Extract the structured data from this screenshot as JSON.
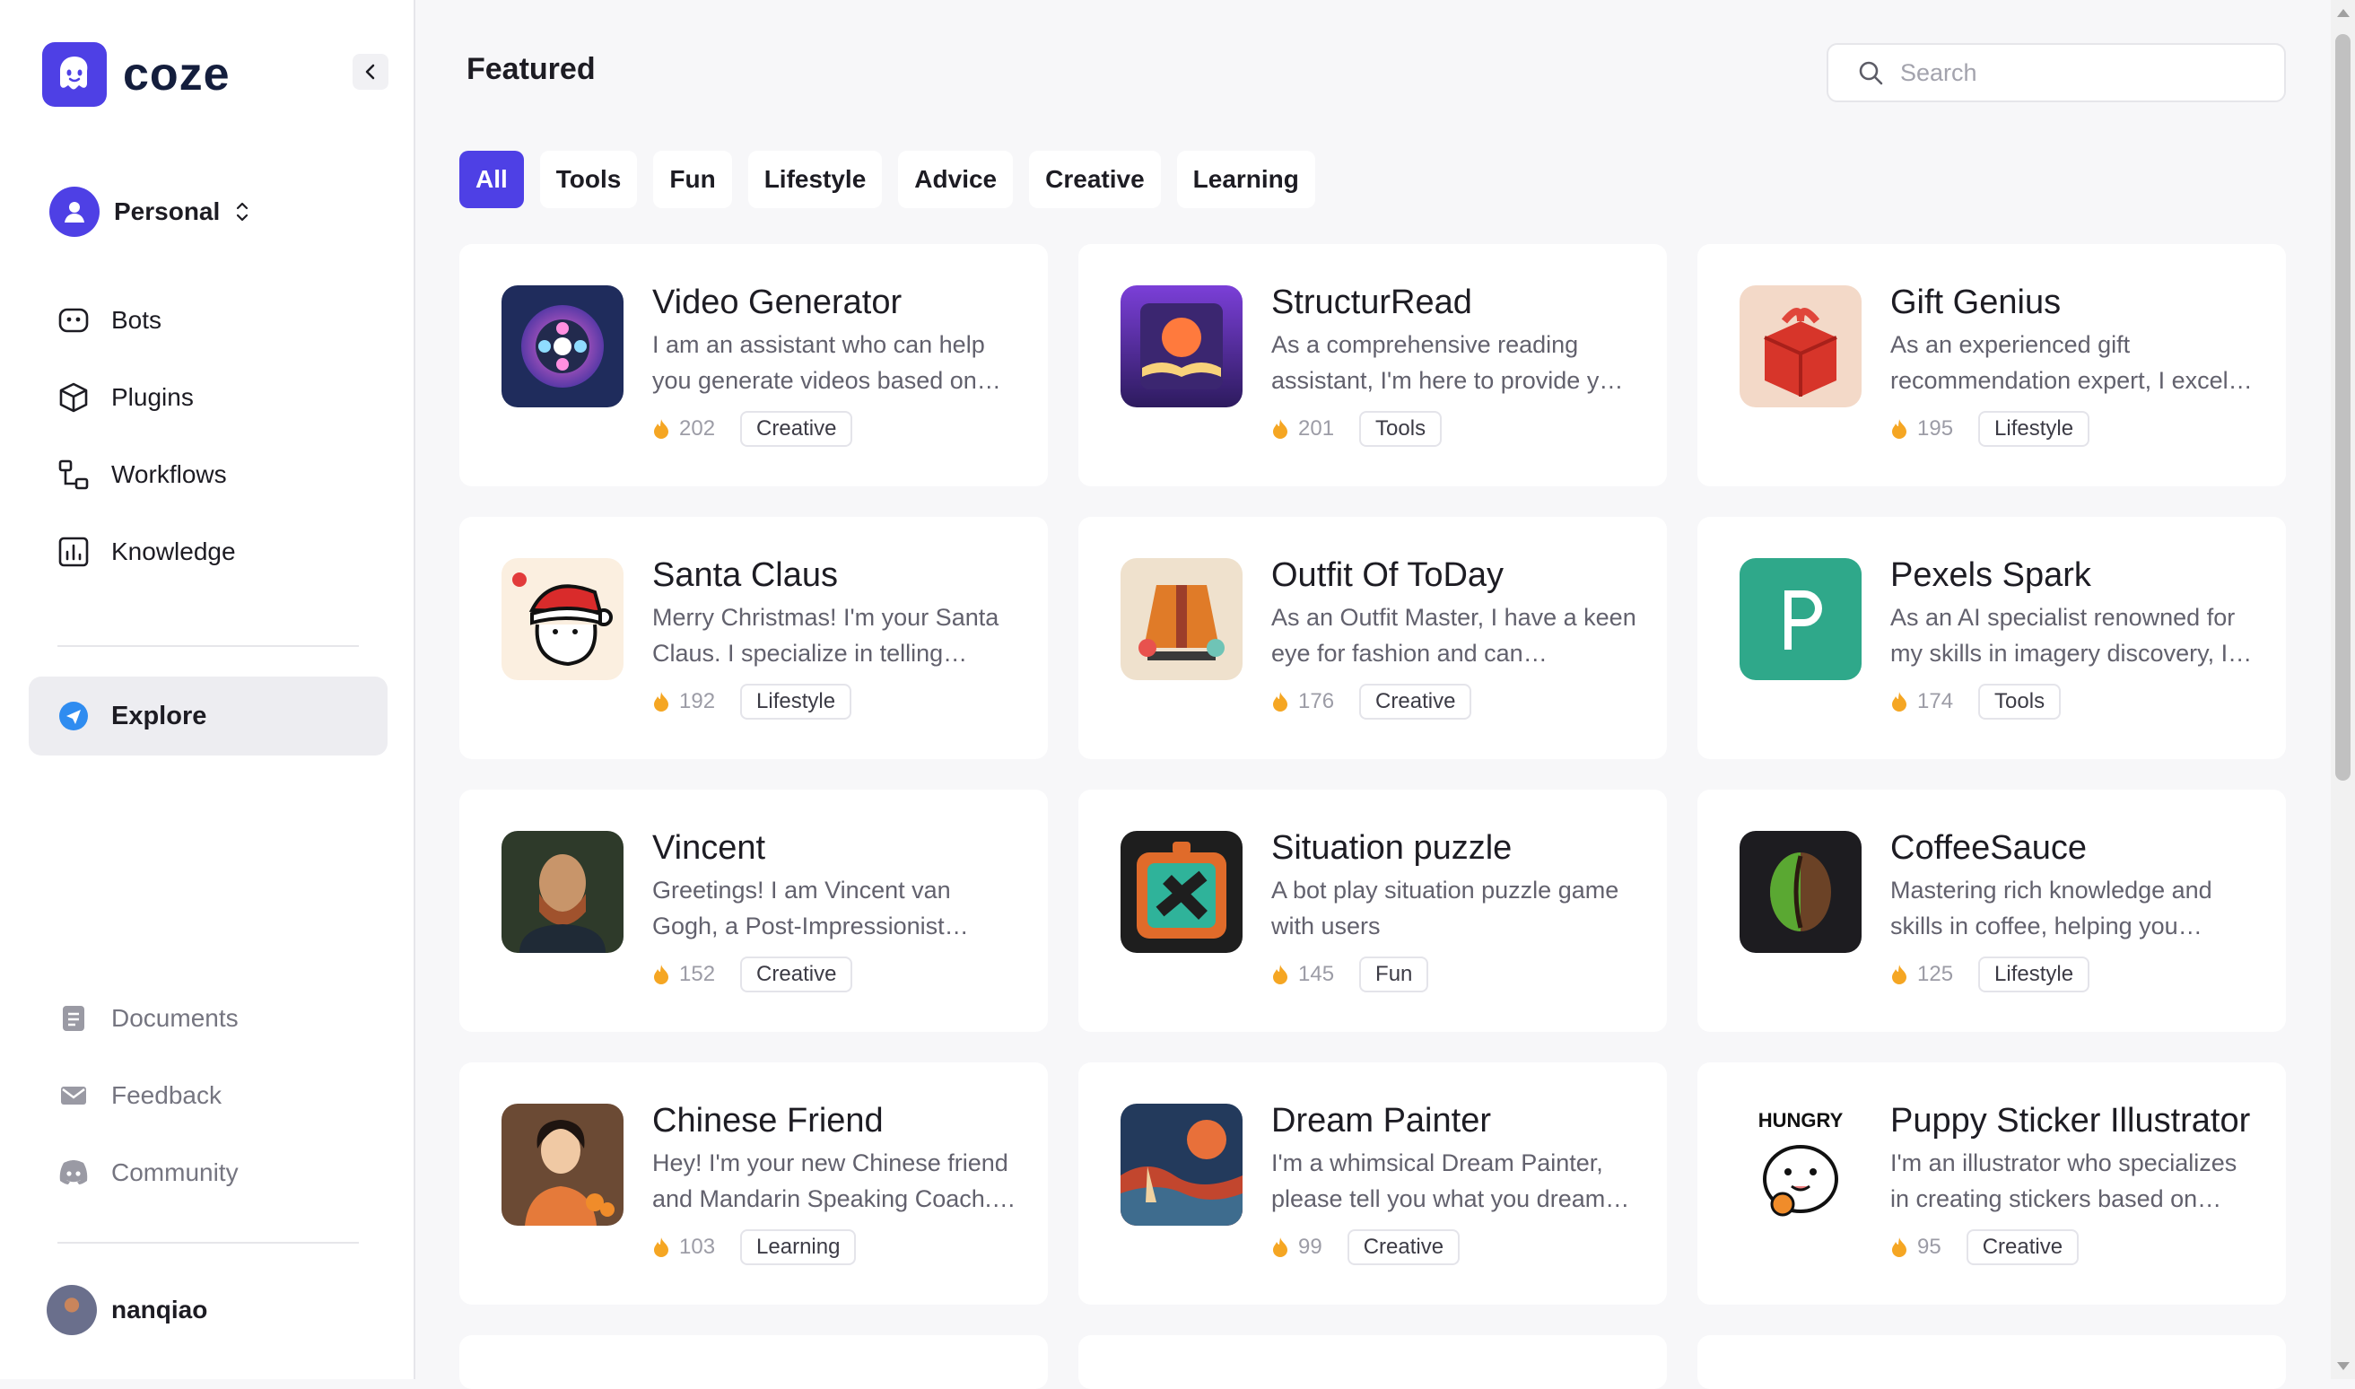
{
  "app": {
    "name": "coze"
  },
  "sidebar": {
    "space": {
      "label": "Personal"
    },
    "nav": [
      {
        "label": "Bots",
        "icon": "bot-icon"
      },
      {
        "label": "Plugins",
        "icon": "cube-icon"
      },
      {
        "label": "Workflows",
        "icon": "workflow-icon"
      },
      {
        "label": "Knowledge",
        "icon": "chart-icon"
      }
    ],
    "explore": {
      "label": "Explore",
      "icon": "compass-icon"
    },
    "bottom": [
      {
        "label": "Documents",
        "icon": "document-icon"
      },
      {
        "label": "Feedback",
        "icon": "mail-icon"
      },
      {
        "label": "Community",
        "icon": "discord-icon"
      }
    ],
    "user": {
      "name": "nanqiao"
    }
  },
  "main": {
    "title": "Featured",
    "search": {
      "placeholder": "Search",
      "value": ""
    },
    "filters": [
      {
        "label": "All",
        "active": true
      },
      {
        "label": "Tools",
        "active": false
      },
      {
        "label": "Fun",
        "active": false
      },
      {
        "label": "Lifestyle",
        "active": false
      },
      {
        "label": "Advice",
        "active": false
      },
      {
        "label": "Creative",
        "active": false
      },
      {
        "label": "Learning",
        "active": false
      }
    ],
    "cards": [
      {
        "title": "Video Generator",
        "desc": "I am an assistant who can help you generate videos based on…",
        "count": "202",
        "tag": "Creative",
        "icon": "film-reel-icon"
      },
      {
        "title": "StructurRead",
        "desc": "As a comprehensive reading assistant, I'm here to provide y…",
        "count": "201",
        "tag": "Tools",
        "icon": "open-book-icon"
      },
      {
        "title": "Gift Genius",
        "desc": "As an experienced gift recommendation expert, I excel…",
        "count": "195",
        "tag": "Lifestyle",
        "icon": "gift-icon"
      },
      {
        "title": "Santa Claus",
        "desc": "Merry Christmas! I'm your Santa Claus. I specialize in telling…",
        "count": "192",
        "tag": "Lifestyle",
        "icon": "santa-icon"
      },
      {
        "title": "Outfit Of ToDay",
        "desc": "As an Outfit Master, I have a keen eye for fashion and can…",
        "count": "176",
        "tag": "Creative",
        "icon": "jacket-icon"
      },
      {
        "title": "Pexels Spark",
        "desc": "As an AI specialist renowned for my skills in imagery discovery, I…",
        "count": "174",
        "tag": "Tools",
        "icon": "pexels-icon"
      },
      {
        "title": "Vincent",
        "desc": "Greetings! I am Vincent van Gogh, a Post-Impressionist…",
        "count": "152",
        "tag": "Creative",
        "icon": "portrait-icon"
      },
      {
        "title": "Situation puzzle",
        "desc": "A bot play situation puzzle game with users",
        "count": "145",
        "tag": "Fun",
        "icon": "puzzle-icon"
      },
      {
        "title": "CoffeeSauce",
        "desc": "Mastering rich knowledge and skills in coffee, helping you…",
        "count": "125",
        "tag": "Lifestyle",
        "icon": "coffee-bean-icon"
      },
      {
        "title": "Chinese Friend",
        "desc": "Hey! I'm your new Chinese friend and Mandarin Speaking Coach.…",
        "count": "103",
        "tag": "Learning",
        "icon": "woman-portrait-icon"
      },
      {
        "title": "Dream Painter",
        "desc": "I'm a whimsical Dream Painter, please tell you what you dream…",
        "count": "99",
        "tag": "Creative",
        "icon": "painting-icon"
      },
      {
        "title": "Puppy Sticker Illustrator",
        "desc": "I'm an illustrator who specializes in creating stickers based on…",
        "count": "95",
        "tag": "Creative",
        "icon": "puppy-sticker-icon"
      }
    ]
  },
  "colors": {
    "accent": "#4e40e5",
    "flame": "#f5a623",
    "pexels": "#2fa88a"
  }
}
